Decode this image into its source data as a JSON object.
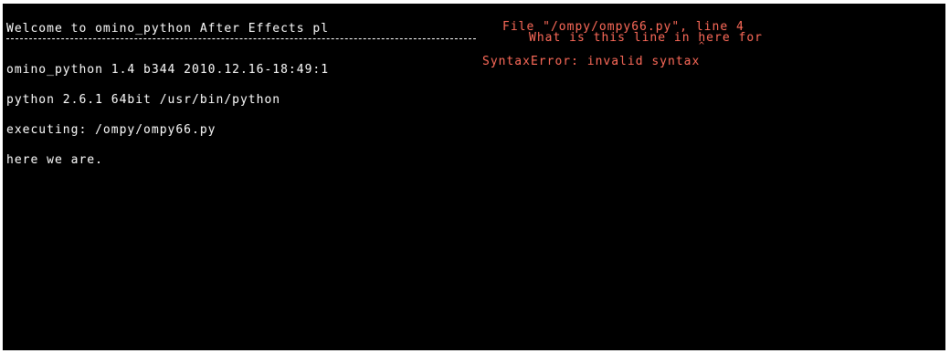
{
  "console": {
    "banner": "Welcome to omino_python After Effects pl",
    "lines": [
      "omino_python 1.4 b344 2010.12.16-18:49:1",
      "python 2.6.1 64bit /usr/bin/python",
      "executing: /ompy/ompy66.py",
      "here we are."
    ],
    "error": {
      "file_line": "File \"/ompy/ompy66.py\", line 4",
      "source_line": "What is this line in here for",
      "caret": "^",
      "message": "SyntaxError: invalid syntax"
    }
  },
  "colors": {
    "background": "#000000",
    "output": "#ffffff",
    "error": "#ff6b5a"
  }
}
